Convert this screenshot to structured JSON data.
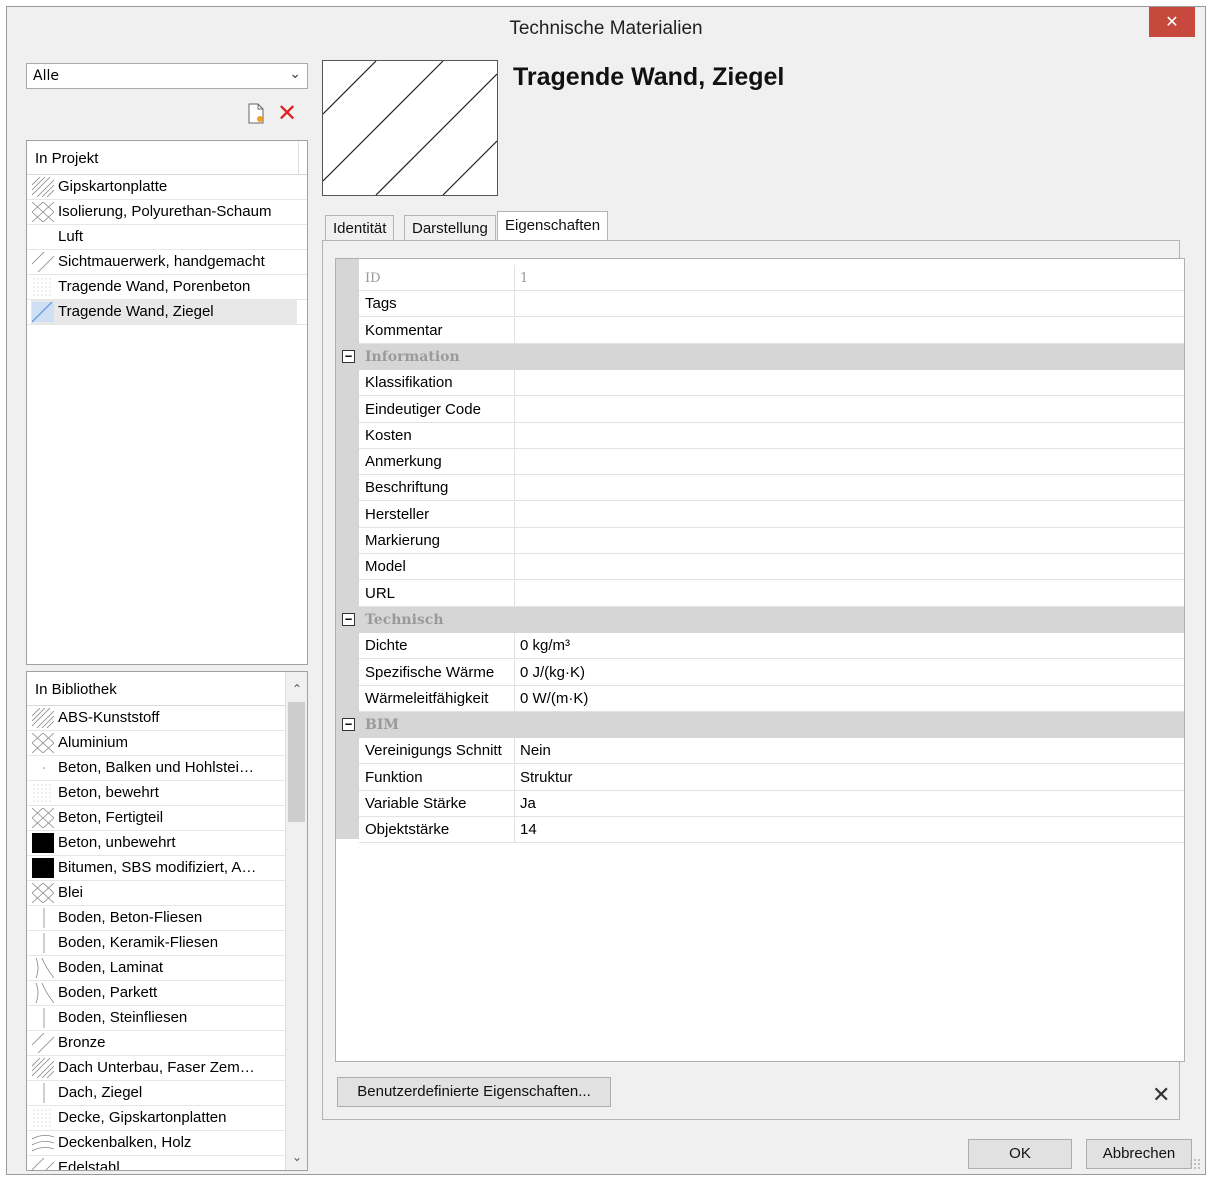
{
  "window": {
    "title": "Technische Materialien",
    "close_glyph": "✕"
  },
  "filter": {
    "selected": "Alle"
  },
  "toolbar": {
    "new_icon": "new-document-icon",
    "delete_icon": "delete-icon",
    "delete_glyph": "✕"
  },
  "project_list": {
    "header": "In Projekt",
    "items": [
      {
        "label": "Gipskartonplatte",
        "pattern": "diag-dense"
      },
      {
        "label": "Isolierung, Polyurethan-Schaum",
        "pattern": "cross"
      },
      {
        "label": "Luft",
        "pattern": "none"
      },
      {
        "label": "Sichtmauerwerk, handgemacht",
        "pattern": "diag-sparse"
      },
      {
        "label": "Tragende Wand, Porenbeton",
        "pattern": "dots"
      },
      {
        "label": "Tragende Wand, Ziegel",
        "pattern": "diag-blue",
        "selected": true
      }
    ]
  },
  "library_list": {
    "header": "In Bibliothek",
    "items": [
      {
        "label": "ABS-Kunststoff",
        "pattern": "diag-dense"
      },
      {
        "label": "Aluminium",
        "pattern": "cross"
      },
      {
        "label": "Beton, Balken und Hohlstei…",
        "pattern": "dot"
      },
      {
        "label": "Beton, bewehrt",
        "pattern": "dots"
      },
      {
        "label": "Beton, Fertigteil",
        "pattern": "cross"
      },
      {
        "label": "Beton, unbewehrt",
        "pattern": "solid"
      },
      {
        "label": "Bitumen, SBS modifiziert, A…",
        "pattern": "solid"
      },
      {
        "label": "Blei",
        "pattern": "cross"
      },
      {
        "label": "Boden, Beton-Fliesen",
        "pattern": "vline"
      },
      {
        "label": "Boden, Keramik-Fliesen",
        "pattern": "vline"
      },
      {
        "label": "Boden, Laminat",
        "pattern": "curve"
      },
      {
        "label": "Boden, Parkett",
        "pattern": "curve"
      },
      {
        "label": "Boden, Steinfliesen",
        "pattern": "vline"
      },
      {
        "label": "Bronze",
        "pattern": "diag-sparse"
      },
      {
        "label": "Dach Unterbau, Faser Zem…",
        "pattern": "diag-dense"
      },
      {
        "label": "Dach, Ziegel",
        "pattern": "vline"
      },
      {
        "label": "Decke, Gipskartonplatten",
        "pattern": "dots"
      },
      {
        "label": "Deckenbalken, Holz",
        "pattern": "wood"
      },
      {
        "label": "Edelstahl",
        "pattern": "diag-sparse"
      }
    ]
  },
  "material": {
    "title": "Tragende Wand, Ziegel"
  },
  "tabs": [
    {
      "label": "Identität"
    },
    {
      "label": "Darstellung"
    },
    {
      "label": "Eigenschaften",
      "active": true
    }
  ],
  "properties": {
    "rows_top": [
      {
        "key": "ID",
        "value": "1",
        "readonly": true
      },
      {
        "key": "Tags",
        "value": ""
      },
      {
        "key": "Kommentar",
        "value": ""
      }
    ],
    "categories": [
      {
        "name": "Information",
        "rows": [
          {
            "key": "Klassifikation",
            "value": ""
          },
          {
            "key": "Eindeutiger Code",
            "value": ""
          },
          {
            "key": "Kosten",
            "value": ""
          },
          {
            "key": "Anmerkung",
            "value": ""
          },
          {
            "key": "Beschriftung",
            "value": ""
          },
          {
            "key": "Hersteller",
            "value": ""
          },
          {
            "key": "Markierung",
            "value": ""
          },
          {
            "key": "Model",
            "value": ""
          },
          {
            "key": "URL",
            "value": ""
          }
        ]
      },
      {
        "name": "Technisch",
        "rows": [
          {
            "key": "Dichte",
            "value": "0 kg/m³"
          },
          {
            "key": "Spezifische Wärme",
            "value": "0 J/(kg·K)"
          },
          {
            "key": "Wärmeleitfähigkeit",
            "value": "0 W/(m·K)"
          }
        ]
      },
      {
        "name": "BIM",
        "rows": [
          {
            "key": "Vereinigungs Schnitt",
            "value": "Nein"
          },
          {
            "key": "Funktion",
            "value": "Struktur"
          },
          {
            "key": "Variable Stärke",
            "value": "Ja"
          },
          {
            "key": "Objektstärke",
            "value": "14"
          }
        ]
      }
    ],
    "collapse_glyph": "−"
  },
  "buttons": {
    "custom_properties": "Benutzerdefinierte Eigenschaften...",
    "remove_glyph": "✕",
    "ok": "OK",
    "cancel": "Abbrechen"
  },
  "colors": {
    "close_red": "#c7493e",
    "delete_red": "#e02020",
    "selection_blue": "#6aa0e0"
  }
}
